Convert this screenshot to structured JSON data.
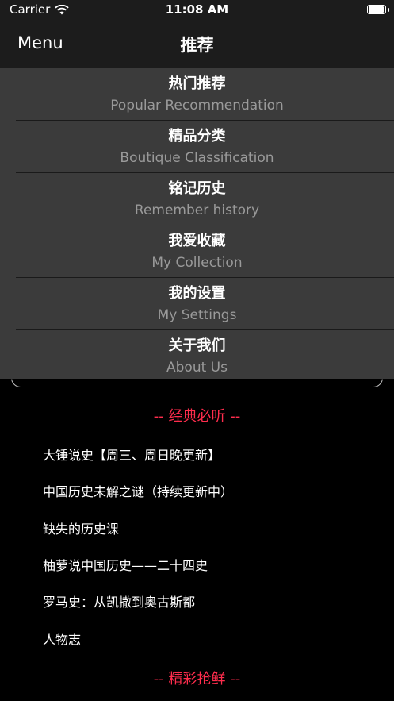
{
  "status_bar": {
    "carrier": "Carrier",
    "time": "11:08 AM",
    "battery_level": 0.95
  },
  "nav": {
    "menu_label": "Menu",
    "title": "推荐"
  },
  "dropdown": {
    "items": [
      {
        "title": "热门推荐",
        "subtitle": "Popular Recommendation"
      },
      {
        "title": "精品分类",
        "subtitle": "Boutique Classification"
      },
      {
        "title": "铭记历史",
        "subtitle": "Remember history"
      },
      {
        "title": "我爱收藏",
        "subtitle": "My Collection"
      },
      {
        "title": "我的设置",
        "subtitle": "My Settings"
      },
      {
        "title": "关于我们",
        "subtitle": "About Us"
      }
    ]
  },
  "content": {
    "section1_title": "-- 经典必听 --",
    "list": [
      "大锤说史【周三、周日晚更新】",
      "中国历史未解之谜（持续更新中）",
      "缺失的历史课",
      "柚萝说中国历史——二十四史",
      "罗马史：从凯撒到奥古斯都",
      "人物志"
    ],
    "section2_title": "-- 精彩抢鲜 --"
  },
  "colors": {
    "accent": "#ff2d4d",
    "bar_bg": "#1c1c1c",
    "dropdown_bg": "#3b3b3b"
  }
}
